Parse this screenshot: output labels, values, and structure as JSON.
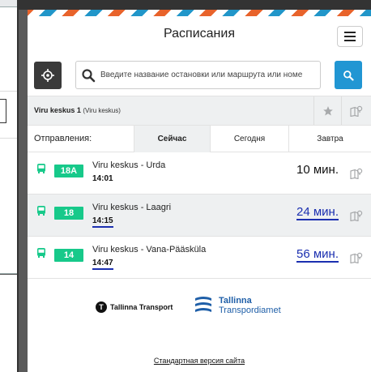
{
  "header": {
    "title": "Расписания"
  },
  "search": {
    "placeholder": "Введите название остановки или маршрута или номе"
  },
  "stop": {
    "name": "Viru keskus 1",
    "alias": "(Viru keskus)"
  },
  "departures_header": {
    "label": "Отправления:",
    "tabs": [
      {
        "label": "Сейчас",
        "active": true
      },
      {
        "label": "Сегодня",
        "active": false
      },
      {
        "label": "Завтра",
        "active": false
      }
    ]
  },
  "departures": [
    {
      "route": "18A",
      "name": "Viru keskus - Urda",
      "time": "14:01",
      "wait": "10 мин.",
      "realtime": false
    },
    {
      "route": "18",
      "name": "Viru keskus - Laagri",
      "time": "14:15",
      "wait": "24 мин.",
      "realtime": true
    },
    {
      "route": "14",
      "name": "Viru keskus - Vana-Pääsküla",
      "time": "14:47",
      "wait": "56 мин.",
      "realtime": true
    }
  ],
  "logos": {
    "tt_name": "Tallinna Transport",
    "ta_line1": "Tallinna",
    "ta_line2": "Transpordiamet"
  },
  "footer": {
    "link": "Стандартная версия сайта"
  },
  "colors": {
    "accent": "#2196d3",
    "route_badge": "#17c98a",
    "realtime": "#1b2fb0"
  },
  "icons": {
    "locate": "crosshair-icon",
    "search": "magnifier-icon",
    "menu": "hamburger-icon",
    "favorite": "star-icon",
    "map": "map-pin-icon",
    "vehicle": "bus-icon"
  }
}
